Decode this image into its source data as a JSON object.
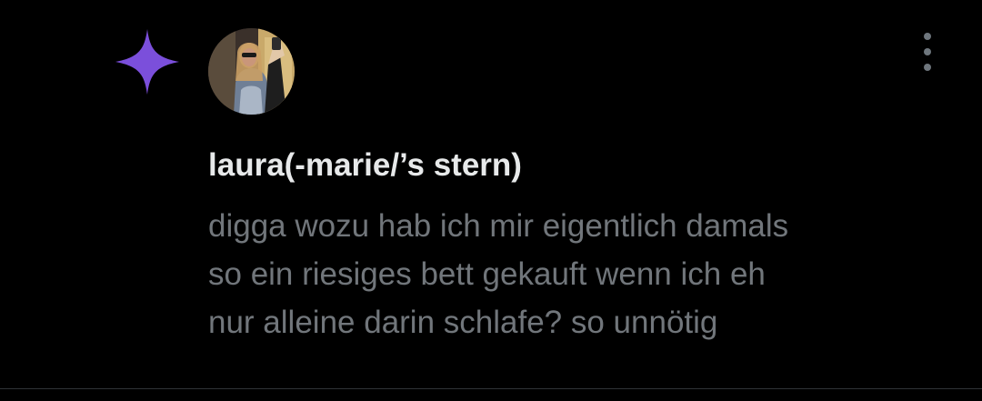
{
  "accent_color": "#7b4fdb",
  "icons": {
    "spark": "four-point-star-icon",
    "more": "vertical-ellipsis-icon"
  },
  "author": {
    "name": "laura(-marie/’s stern)",
    "avatar": "profile-photo"
  },
  "post": {
    "lines": [
      "digga wozu hab ich mir eigentlich damals",
      "so ein riesiges bett gekauft wenn ich eh",
      "nur alleine darin schlafe? so unnötig"
    ]
  }
}
